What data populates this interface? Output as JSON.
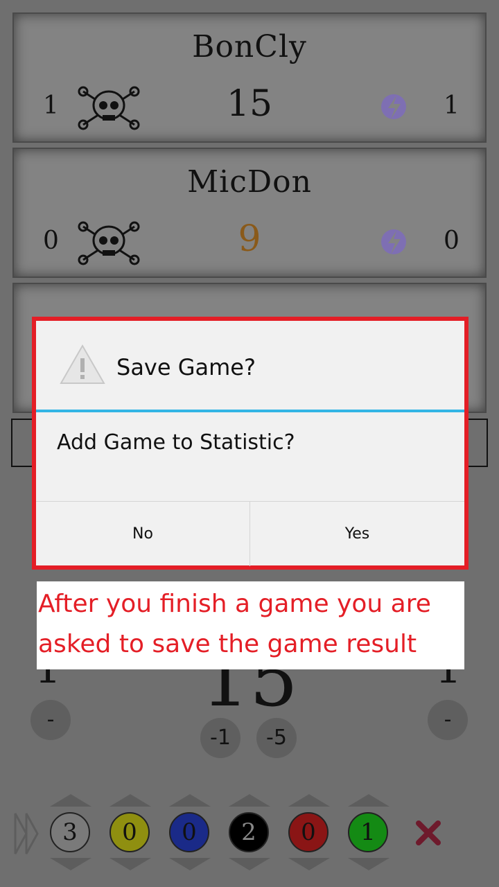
{
  "players": [
    {
      "name": "BonCly",
      "left_count": "1",
      "score": "15",
      "right_count": "1",
      "score_color": "#111111"
    },
    {
      "name": "MicDon",
      "left_count": "0",
      "score": "9",
      "right_count": "0",
      "score_color": "#8a5a1a"
    }
  ],
  "active_player": {
    "left_count": "1",
    "score": "15",
    "right_count": "1",
    "minus_left": "-",
    "minus_right": "-",
    "decrement_1": "-1",
    "decrement_5": "-5"
  },
  "tokens": [
    {
      "value": "3",
      "color": "#7a7a7a"
    },
    {
      "value": "0",
      "color": "#8f8f10"
    },
    {
      "value": "0",
      "color": "#1a2a88"
    },
    {
      "value": "2",
      "color": "#000000"
    },
    {
      "value": "0",
      "color": "#8a1515"
    },
    {
      "value": "1",
      "color": "#148a14"
    }
  ],
  "dialog": {
    "title": "Save Game?",
    "message": "Add Game to Statistic?",
    "no_label": "No",
    "yes_label": "Yes"
  },
  "caption": "After you finish a game you are asked to save the game result",
  "colors": {
    "highlight": "#e41e26",
    "divider": "#33b5e5",
    "bolt": "#7c66c8"
  }
}
